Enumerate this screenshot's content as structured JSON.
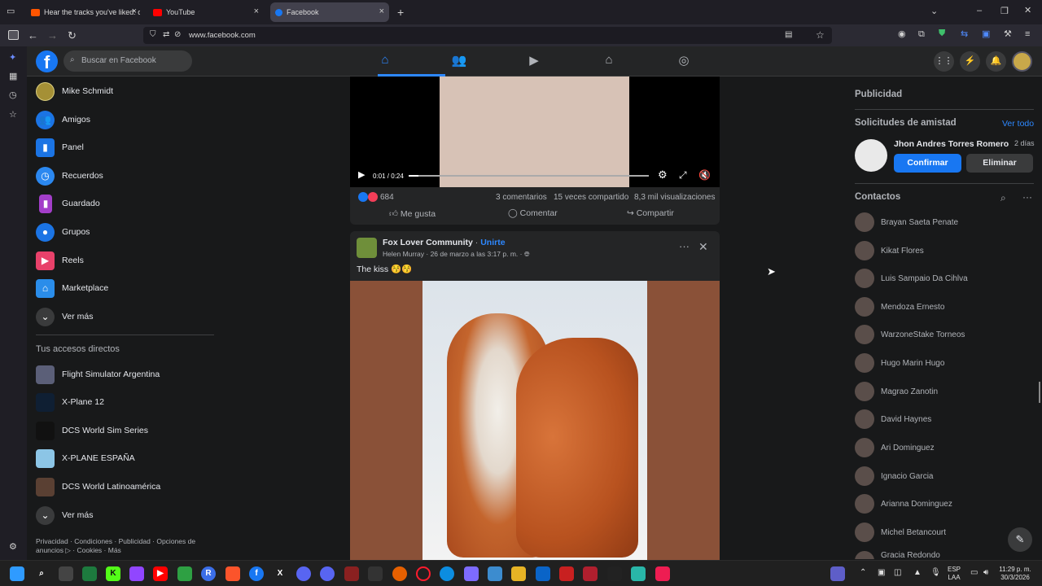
{
  "browser": {
    "tabs": [
      {
        "label": "Hear the tracks you've liked: on",
        "color": "#ff5500"
      },
      {
        "label": "YouTube",
        "color": "#ff0000"
      },
      {
        "label": "Facebook",
        "color": "#1877f2"
      }
    ],
    "url": "www.facebook.com",
    "new_tab_icon": "+"
  },
  "fb": {
    "search_placeholder": "Buscar en Facebook",
    "logo_letter": "f"
  },
  "sidebar": {
    "items": [
      {
        "label": "Mike Schmidt",
        "icon": "avatar"
      },
      {
        "label": "Amigos",
        "icon": "friends-icon"
      },
      {
        "label": "Panel",
        "icon": "dashboard-icon"
      },
      {
        "label": "Recuerdos",
        "icon": "clock-icon"
      },
      {
        "label": "Guardado",
        "icon": "bookmark-icon"
      },
      {
        "label": "Grupos",
        "icon": "groups-icon"
      },
      {
        "label": "Reels",
        "icon": "reels-icon"
      },
      {
        "label": "Marketplace",
        "icon": "store-icon"
      },
      {
        "label": "Ver más",
        "icon": "chevron-down-icon"
      }
    ],
    "shortcuts_title": "Tus accesos directos",
    "shortcuts": [
      {
        "label": "Flight Simulator Argentina"
      },
      {
        "label": "X-Plane 12"
      },
      {
        "label": "DCS World Sim Series"
      },
      {
        "label": "X-PLANE ESPAÑA"
      },
      {
        "label": "DCS World Latinoamérica"
      }
    ],
    "shortcuts_more": "Ver más",
    "footer_line1": "Privacidad · Condiciones · Publicidad · Opciones de",
    "footer_line2": "anuncios ▷ · Cookies · Más"
  },
  "video_post": {
    "time": "0:01 / 0:24",
    "progress": 0.04,
    "reactions_count": "684",
    "comments": "3 comentarios",
    "shares": "15 veces compartido",
    "views": "8,3 mil visualizaciones",
    "like_label": "Me gusta",
    "comment_label": "Comentar",
    "share_label": "Compartir"
  },
  "post2": {
    "page_name": "Fox Lover Community",
    "join_label": "Unirte",
    "author_line": "Helen Murray · 26 de marzo a las 3:17 p. m. · ",
    "text": "The kiss 😚😚"
  },
  "right": {
    "ads_title": "Publicidad",
    "requests_title": "Solicitudes de amistad",
    "see_all": "Ver todo",
    "request": {
      "name": "Jhon Andres Torres Romero",
      "age": "2 días",
      "confirm": "Confirmar",
      "delete": "Eliminar"
    },
    "contacts_title": "Contactos",
    "contacts": [
      "Brayan Saeta Penate",
      "Kikat Flores",
      "Luis Sampaio Da Cihlva",
      "Mendoza Ernesto",
      "WarzoneStake Torneos",
      "Hugo Marin Hugo",
      "Magrao Zanotin",
      "David Haynes",
      "Ari Dominguez",
      "Ignacio Garcia",
      "Arianna Dominguez",
      "Michel Betancourt",
      "Gracia Redondo"
    ]
  },
  "taskbar": {
    "lang_line1": "ESP",
    "lang_line2": "LAA",
    "time": "11:29 p. m.",
    "date": "30/3/2026"
  }
}
